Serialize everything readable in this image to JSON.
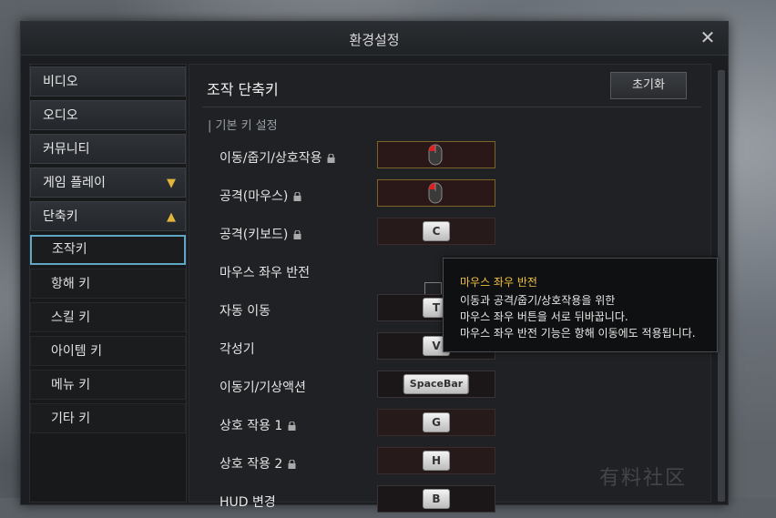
{
  "window": {
    "title": "환경설정"
  },
  "sidebar": {
    "items": [
      {
        "label": "비디오",
        "chevron": ""
      },
      {
        "label": "오디오",
        "chevron": ""
      },
      {
        "label": "커뮤니티",
        "chevron": ""
      },
      {
        "label": "게임 플레이",
        "chevron": "chevron-down-icon"
      },
      {
        "label": "단축키",
        "chevron": "chevron-up-icon"
      }
    ],
    "subitems": [
      {
        "label": "조작키",
        "active": true
      },
      {
        "label": "항해 키",
        "active": false
      },
      {
        "label": "스킬 키",
        "active": false
      },
      {
        "label": "아이템 키",
        "active": false
      },
      {
        "label": "메뉴 키",
        "active": false
      },
      {
        "label": "기타 키",
        "active": false
      }
    ]
  },
  "main": {
    "title": "조작 단축키",
    "reset_label": "초기화",
    "section_label": "| 기본 키 설정",
    "rows": [
      {
        "label": "이동/줍기/상호작용",
        "locked": true,
        "key": "mouse-left-icon"
      },
      {
        "label": "공격(마우스)",
        "locked": true,
        "key": "mouse-left-icon"
      },
      {
        "label": "공격(키보드)",
        "locked": true,
        "key": "C"
      },
      {
        "label": "마우스 좌우 반전",
        "locked": false,
        "key": "checkbox"
      },
      {
        "label": "자동 이동",
        "locked": false,
        "key": "T"
      },
      {
        "label": "각성기",
        "locked": false,
        "key": "V"
      },
      {
        "label": "이동기/기상액션",
        "locked": false,
        "key": "SpaceBar"
      },
      {
        "label": "상호 작용 1",
        "locked": true,
        "key": "G"
      },
      {
        "label": "상호 작용 2",
        "locked": true,
        "key": "H"
      },
      {
        "label": "HUD 변경",
        "locked": false,
        "key": "B"
      }
    ]
  },
  "tooltip": {
    "title": "마우스 좌우 반전",
    "lines": [
      "이동과 공격/줍기/상호작용을 위한",
      "마우스 좌우 버튼을 서로 뒤바꿉니다.",
      "마우스 좌우 반전 기능은 항해 이동에도 적용됩니다."
    ]
  },
  "watermark": "有料社区",
  "colors": {
    "accent": "#e2b43a",
    "active_border": "#5fa7c4",
    "tooltip_title": "#f0c040"
  }
}
